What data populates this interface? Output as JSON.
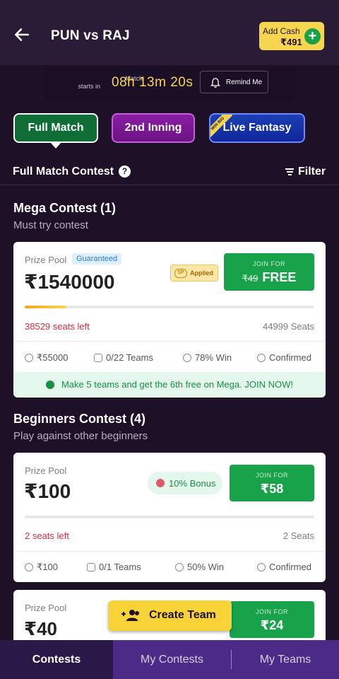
{
  "header": {
    "title": "PUN vs RAJ",
    "add_cash_label": "Add Cash",
    "balance": "₹491"
  },
  "timer": {
    "label_line1": "Match",
    "label_line2": "starts in",
    "countdown": "08h 13m 20s",
    "remind_label": "Remind Me"
  },
  "tabs": [
    {
      "label": "Full Match",
      "active": true
    },
    {
      "label": "2nd Inning",
      "active": false
    },
    {
      "label": "Live Fantasy",
      "badge": "WIN BIG",
      "active": false
    }
  ],
  "contest_header": {
    "title": "Full Match Contest",
    "filter_label": "Filter"
  },
  "sections": [
    {
      "title": "Mega Contest (1)",
      "subtitle": "Must try contest",
      "cards": [
        {
          "prize_label": "Prize Pool",
          "badge": "Guaranteed",
          "prize": "₹1540000",
          "applied_tag": "SP",
          "applied_label": "Applied",
          "join_label": "JOIN FOR",
          "join_old": "₹49",
          "join_price": "FREE",
          "fill_fraction": 0.144,
          "seats_left": "38529 seats left",
          "seats_total": "44999 Seats",
          "first_prize": "₹55000",
          "teams": "0/22 Teams",
          "win": "78% Win",
          "status": "Confirmed",
          "promo": "Make 5 teams and get the 6th free on Mega. JOIN NOW!"
        }
      ]
    },
    {
      "title": "Beginners Contest (4)",
      "subtitle": "Play against other beginners",
      "cards": [
        {
          "prize_label": "Prize Pool",
          "prize": "₹100",
          "bonus": "10% Bonus",
          "join_label": "JOIN FOR",
          "join_price": "₹58",
          "fill_fraction": 0,
          "seats_left": "2 seats left",
          "seats_total": "2 Seats",
          "first_prize": "₹100",
          "teams": "0/1 Teams",
          "win": "50% Win",
          "status": "Confirmed"
        },
        {
          "prize_label": "Prize Pool",
          "prize": "₹40",
          "join_label": "JOIN FOR",
          "join_price": "₹24"
        }
      ]
    }
  ],
  "create_team_label": "Create Team",
  "bottom_nav": [
    {
      "label": "Contests",
      "active": true
    },
    {
      "label": "My Contests",
      "active": false
    },
    {
      "label": "My Teams",
      "active": false
    }
  ],
  "colors": {
    "background": "#1e1027",
    "accent_yellow": "#f7d64f",
    "join_green": "#18a24a",
    "seats_left_red": "#d62c3c"
  }
}
